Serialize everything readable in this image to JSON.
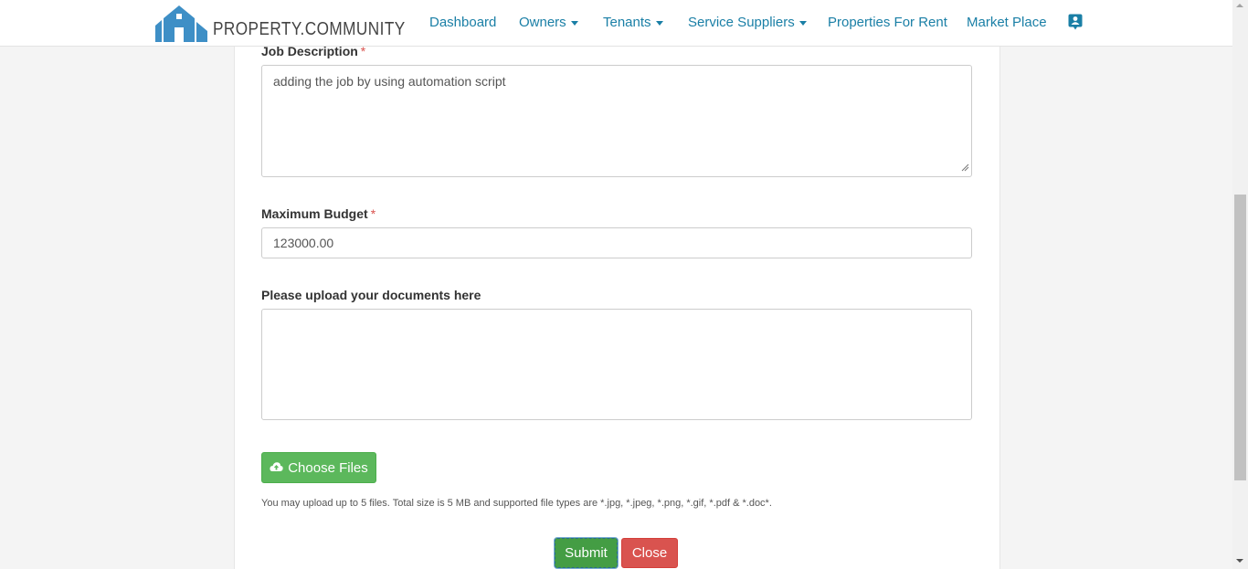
{
  "brand": {
    "name": "PROPERTY.COMMUNITY",
    "logo_icon": "house-logo-icon",
    "color": "#3e8fc6"
  },
  "nav": {
    "items": [
      {
        "label": "Dashboard",
        "has_dropdown": false
      },
      {
        "label": "Owners",
        "has_dropdown": true
      },
      {
        "label": "Tenants",
        "has_dropdown": true
      },
      {
        "label": "Service Suppliers",
        "has_dropdown": true
      },
      {
        "label": "Properties For Rent",
        "has_dropdown": false
      },
      {
        "label": "Market Place",
        "has_dropdown": false
      }
    ],
    "profile_icon": "contact-card-icon",
    "link_color": "#1a7fa6"
  },
  "form": {
    "job_description": {
      "label": "Job Description",
      "required_mark": "*",
      "value": "adding the job by using automation script"
    },
    "max_budget": {
      "label": "Maximum Budget",
      "required_mark": "*",
      "value": "123000.00"
    },
    "upload": {
      "label": "Please upload your documents here",
      "choose_button": "Choose Files",
      "choose_icon": "cloud-upload-icon",
      "help_text": "You may upload up to 5 files. Total size is 5 MB and supported file types are *.jpg, *.jpeg, *.png, *.gif, *.pdf & *.doc*."
    },
    "submit_label": "Submit",
    "close_label": "Close"
  },
  "colors": {
    "success": "#5cb85c",
    "danger": "#d9534f",
    "required": "#d9534f"
  }
}
